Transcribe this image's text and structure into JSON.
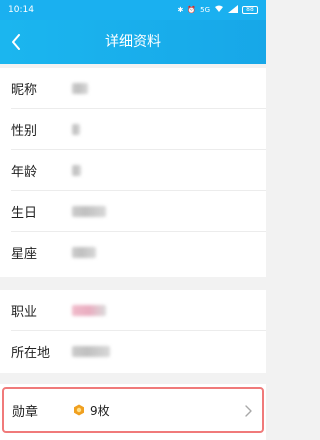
{
  "status_bar": {
    "time": "10:14",
    "network": "5G",
    "battery": "88"
  },
  "header": {
    "title": "详细资料"
  },
  "profile": {
    "nickname_label": "昵称",
    "gender_label": "性别",
    "age_label": "年龄",
    "birthday_label": "生日",
    "constellation_label": "星座",
    "occupation_label": "职业",
    "location_label": "所在地"
  },
  "medals": {
    "label": "勋章",
    "count": "9枚"
  },
  "colors": {
    "brand": "#1ab0f0",
    "highlight_border": "#f07a7a",
    "medal_gold": "#f0a020"
  },
  "icons": {
    "back": "back-arrow-icon",
    "medal": "medal-icon",
    "chevron": "chevron-right-icon"
  }
}
